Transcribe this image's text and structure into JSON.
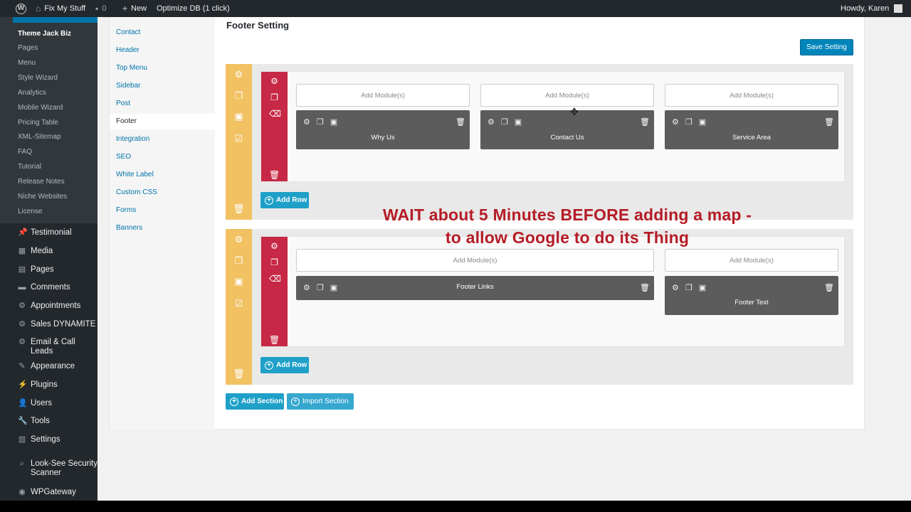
{
  "adminbar": {
    "site_name": "Fix My Stuff",
    "comments_count": "0",
    "new_label": "New",
    "optimize_label": "Optimize DB (1 click)",
    "howdy": "Howdy, Karen"
  },
  "sidebar": {
    "submenu": [
      "Theme Jack Biz",
      "Pages",
      "Menu",
      "Style Wizard",
      "Analytics",
      "Mobile Wizard",
      "Pricing Table",
      "XML-Sitemap",
      "FAQ",
      "Tutorial",
      "Release Notes",
      "Niche Websites",
      "License"
    ],
    "menu": [
      {
        "label": "Testimonial",
        "icon": "pin-icon"
      },
      {
        "label": "Media",
        "icon": "media-icon"
      },
      {
        "label": "Pages",
        "icon": "pages-icon"
      },
      {
        "label": "Comments",
        "icon": "comments-icon"
      },
      {
        "label": "Appointments",
        "icon": "gear-icon"
      },
      {
        "label": "Sales DYNAMITE",
        "icon": "gear-icon"
      },
      {
        "label": "Email & Call Leads",
        "icon": "gear-icon"
      },
      {
        "label": "Appearance",
        "icon": "brush-icon"
      },
      {
        "label": "Plugins",
        "icon": "plug-icon"
      },
      {
        "label": "Users",
        "icon": "users-icon"
      },
      {
        "label": "Tools",
        "icon": "wrench-icon"
      },
      {
        "label": "Settings",
        "icon": "settings-icon"
      },
      {
        "label": "Look-See Security Scanner",
        "icon": "search-icon"
      },
      {
        "label": "WPGateway",
        "icon": "gateway-icon"
      }
    ]
  },
  "tabs": [
    "Contact",
    "Header",
    "Top Menu",
    "Sidebar",
    "Post",
    "Footer",
    "Integration",
    "SEO",
    "White Label",
    "Custom CSS",
    "Forms",
    "Banners"
  ],
  "page_title": "Footer Setting",
  "save_label": "Save Setting",
  "add_module_label": "Add Module(s)",
  "add_row_label": "Add Row",
  "add_section_label": "Add Section",
  "import_section_label": "Import Section",
  "section1": {
    "modules": [
      "Why Us",
      "Contact Us",
      "Service Area"
    ]
  },
  "section2": {
    "modules": [
      "Footer Links",
      "Footer Text"
    ]
  },
  "overlay": {
    "line1": "WAIT about 5 Minutes BEFORE adding a map -",
    "line2": "to allow Google to do its Thing"
  },
  "colors": {
    "section_bar": "#f1c162",
    "row_bar": "#c72845",
    "overlay_text": "#b51c26",
    "save_button": "#0085ba",
    "teal_button": "#1ea0c8"
  }
}
